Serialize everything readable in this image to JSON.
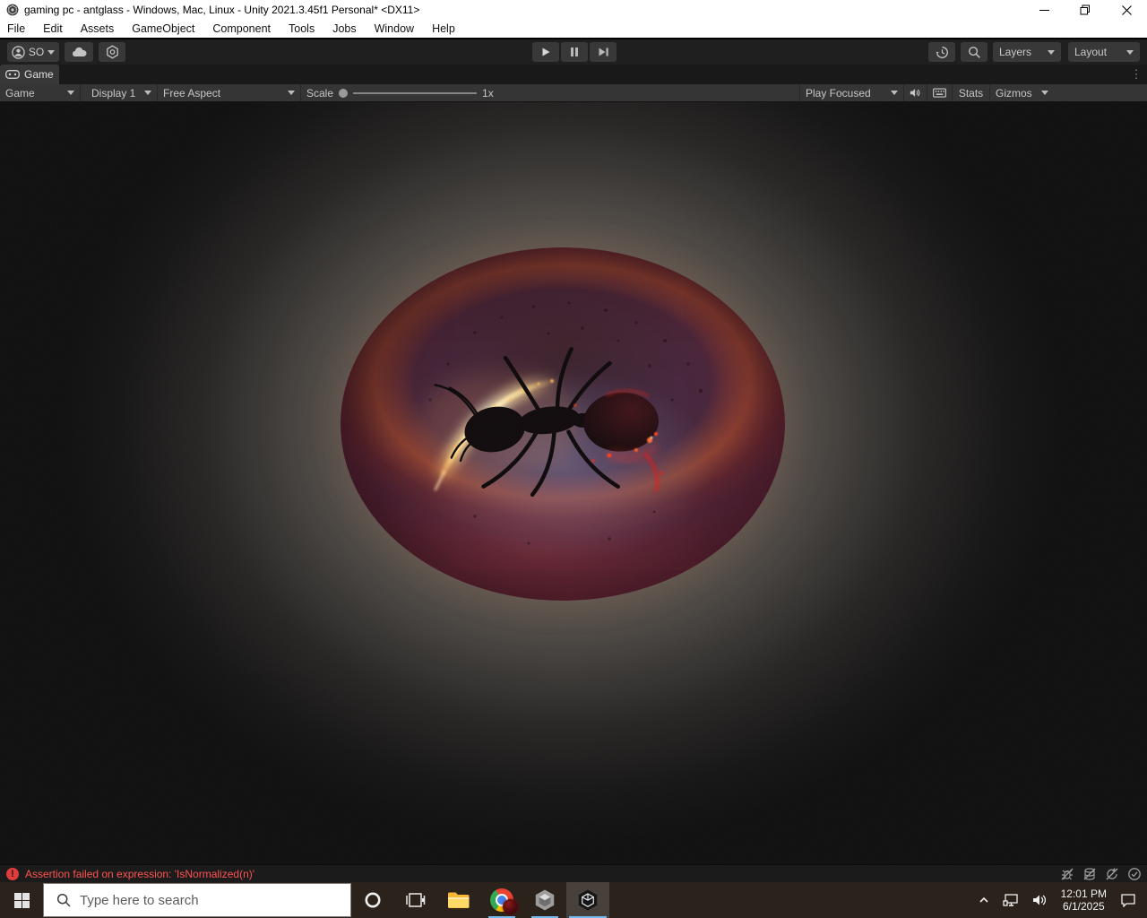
{
  "window": {
    "title": "gaming pc - antglass - Windows, Mac, Linux - Unity 2021.3.45f1 Personal* <DX11>"
  },
  "menu_bar": {
    "items": [
      "File",
      "Edit",
      "Assets",
      "GameObject",
      "Component",
      "Tools",
      "Jobs",
      "Window",
      "Help"
    ]
  },
  "toolbar": {
    "account_label": "SO",
    "layers_label": "Layers",
    "layout_label": "Layout"
  },
  "game_tab": {
    "label": "Game",
    "overflow_glyph": "⋮"
  },
  "game_toolbar": {
    "view_dropdown": "Game",
    "display_dropdown": "Display 1",
    "aspect_dropdown": "Free Aspect",
    "scale_label": "Scale",
    "scale_value": "1x",
    "play_focused_dropdown": "Play Focused",
    "stats_label": "Stats",
    "gizmos_label": "Gizmos"
  },
  "status_bar": {
    "error_badge": "!",
    "error_text": "Assertion failed on expression: 'IsNormalized(n)'"
  },
  "taskbar": {
    "search_placeholder": "Type here to search",
    "clock_time": "12:01 PM",
    "clock_date": "6/1/2025"
  },
  "colors": {
    "error_red": "#ff5252",
    "taskbar_running_indicator": "#76b9ed",
    "amber_rim": "#7a1e36",
    "amber_ring": "#d65c26",
    "light_streak": "#fff2c4",
    "halo_gray": "#8a837b"
  }
}
